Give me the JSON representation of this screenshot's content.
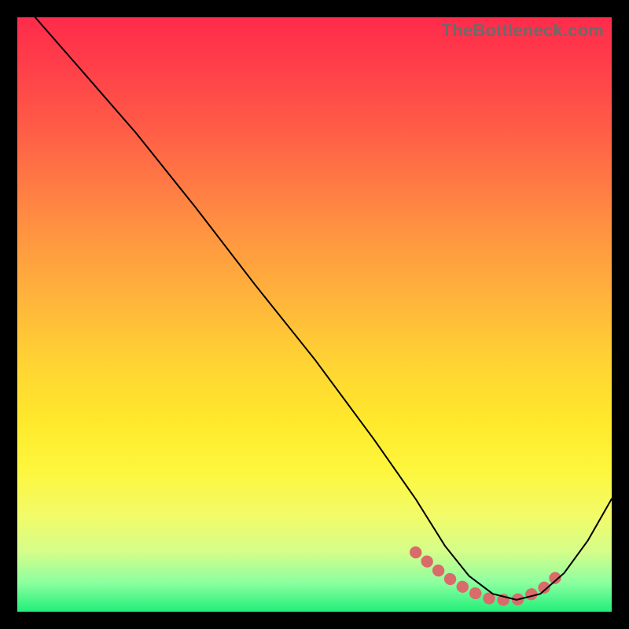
{
  "watermark": "TheBottleneck.com",
  "trough_color": "#d96b6b",
  "trough_width": 15,
  "curve_color": "#000000",
  "curve_width": 2,
  "chart_data": {
    "type": "line",
    "title": "",
    "xlabel": "",
    "ylabel": "",
    "xlim": [
      0,
      100
    ],
    "ylim": [
      0,
      100
    ],
    "series": [
      {
        "name": "bottleneck-curve",
        "x": [
          3,
          10,
          20,
          30,
          40,
          50,
          60,
          67,
          72,
          76,
          80,
          84,
          88,
          92,
          96,
          100
        ],
        "y": [
          100,
          92,
          80.5,
          68,
          55,
          42.5,
          29,
          19,
          11,
          6,
          3,
          2,
          3,
          6.5,
          12,
          19
        ]
      }
    ],
    "trough_region": {
      "x": [
        67,
        72,
        76,
        80,
        84,
        88,
        92
      ],
      "y": [
        10,
        6,
        3.5,
        2,
        2,
        3.5,
        7
      ]
    }
  }
}
